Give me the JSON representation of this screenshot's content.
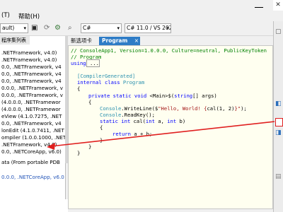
{
  "menu": {
    "items": [
      "(T)",
      "帮助(H)"
    ]
  },
  "toolbar": {
    "framework_combo": "ault)",
    "language_combo": "C#",
    "version_combo": "C# 11.0 / VS 202"
  },
  "left_panel": {
    "tab_label": "程序集列表",
    "assemblies": [
      ".NETFramework, v4.0)",
      ".NETFramework, v4.0)",
      "0.0, .NETFramework, v4",
      "0.0, .NETFramework, v4",
      "0.0, .NETFramework, v4",
      "0.0.0, .NETFramework, v",
      "0.0.0, .NETFramework, v",
      "(4.0.0.0, .NETFramewor",
      "(4.0.0.0, .NETFramewor",
      "eView (4.1.0.7275, .NET",
      "0.0, .NETFramework, v4",
      "lonEdit (4.1.0.7411, .NET",
      "ompiler (1.0.0.1000, .NET",
      ".NETFramework, v4.0)",
      "0.0, .NETCoreApp, v6.0)"
    ],
    "data_item": "ata (From portable PDB",
    "bottom_item": "0.0.0, .NETCoreApp, v6.0"
  },
  "tabs": [
    {
      "label": "新选项卡"
    },
    {
      "label": "Program",
      "close": "×"
    }
  ],
  "code": {
    "line1": "// ConsoleApp1, Version=1.0.0.0, Culture=neutral, PublicKeyToken",
    "line2": "// Program",
    "line3_kw": "using",
    "line3_rest": " ...",
    "line4": "[CompilerGenerated]",
    "line5_kw": "internal class",
    "line5_ty": " Program",
    "line6": "{",
    "line7_kw": "private static void",
    "line7_rest": " <Main>$(",
    "line7_kw2": "string",
    "line7_rest2": "[] args)",
    "line8": "{",
    "line9_a": "Console",
    "line9_b": ".WriteLine($",
    "line9_str": "\"Hello, World! {",
    "line9_c": "cal(1, 2)",
    "line9_str2": "}\"",
    "line9_d": ");",
    "line10_a": "Console",
    "line10_b": ".ReadKey();",
    "line11_kw": "static int",
    "line11_rest": " cal(",
    "line11_kw2": "int",
    "line11_rest2": " a, ",
    "line11_kw3": "int",
    "line11_rest3": " b)",
    "line12": "{",
    "line13_kw": "return",
    "line13_rest": " a + b;",
    "line14": "}",
    "line15": "}",
    "line16": "}"
  },
  "colors": {
    "tab_active": "#2e7cc6",
    "code_bg": "#fffff0",
    "annotation": "#e02020"
  }
}
